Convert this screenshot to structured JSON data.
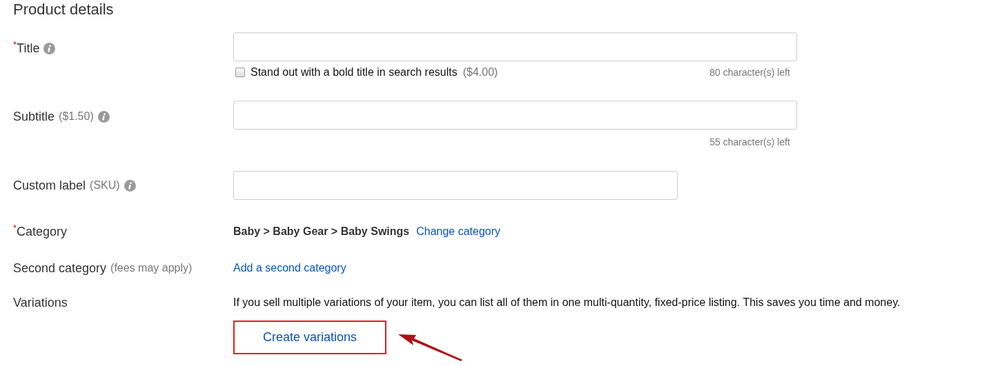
{
  "heading": "Product details",
  "fields": [
    {
      "kind": "wide-input",
      "required_mark": "*",
      "label": "Title",
      "info": true,
      "option": {
        "label": "Stand out with a bold title in search results",
        "price": "($4.00)",
        "checked": false
      },
      "counter": "80 character(s) left"
    },
    {
      "kind": "wide-input",
      "label": "Subtitle",
      "note": "($1.50)",
      "info": true,
      "counter": "55 character(s) left"
    },
    {
      "kind": "narrow-input",
      "label": "Custom label",
      "note": "(SKU)",
      "info": true
    },
    {
      "kind": "category",
      "required_mark": "*",
      "label": "Category",
      "path": "Baby > Baby Gear > Baby Swings",
      "link": "Change category"
    },
    {
      "kind": "link",
      "label": "Second category",
      "note": "(fees may apply)",
      "link": "Add a second category"
    },
    {
      "kind": "variations",
      "label": "Variations",
      "text": "If you sell multiple variations of your item, you can list all of them in one multi-quantity, fixed-price listing. This saves you time and money.",
      "button": "Create variations",
      "highlighted": true
    }
  ]
}
